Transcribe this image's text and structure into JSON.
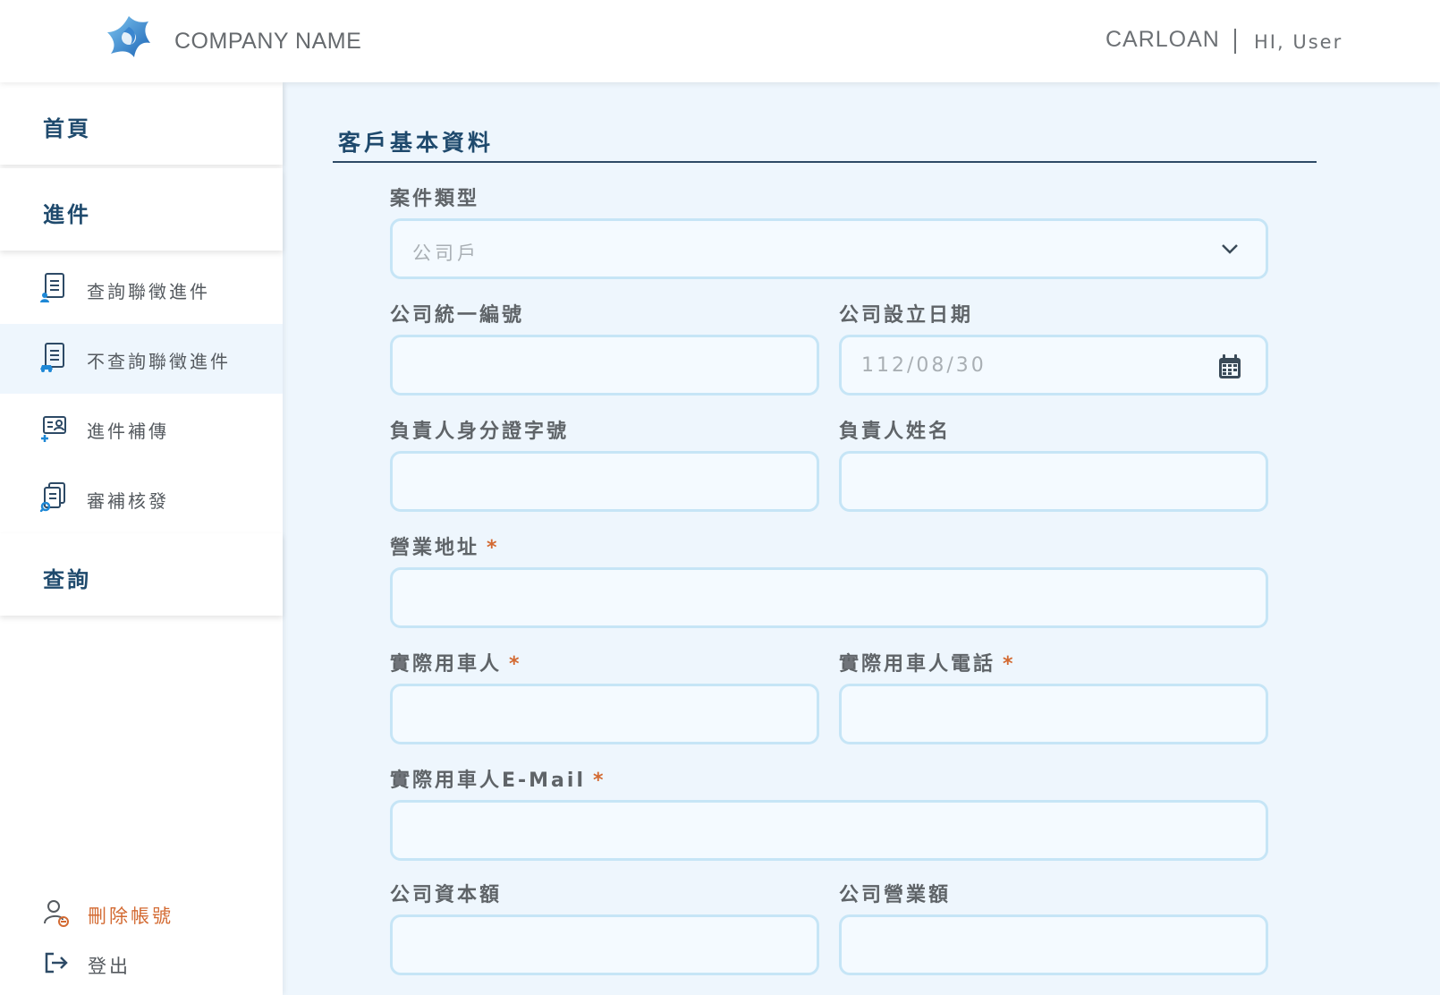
{
  "header": {
    "company_name": "COMPANY NAME",
    "app_name": "CARLOAN",
    "greeting": "HI, User"
  },
  "sidebar": {
    "home": "首頁",
    "intake": "進件",
    "intake_items": [
      {
        "label": "查詢聯徵進件",
        "icon": "document-person-icon"
      },
      {
        "label": "不查詢聯徵進件",
        "icon": "document-car-icon"
      },
      {
        "label": "進件補傳",
        "icon": "id-card-add-icon"
      },
      {
        "label": "審補核發",
        "icon": "documents-search-icon"
      }
    ],
    "active_item": "不查詢聯徵進件",
    "query": "查詢",
    "delete_account": "刪除帳號",
    "logout": "登出"
  },
  "form": {
    "title": "客戶基本資料",
    "case_type": {
      "label": "案件類型",
      "value": "公司戶"
    },
    "company_id": {
      "label": "公司統一編號",
      "value": ""
    },
    "established_date": {
      "label": "公司設立日期",
      "placeholder": "112/08/30"
    },
    "owner_id": {
      "label": "負責人身分證字號",
      "value": ""
    },
    "owner_name": {
      "label": "負責人姓名",
      "value": ""
    },
    "business_address": {
      "label": "營業地址",
      "required_mark": "*"
    },
    "actual_user": {
      "label": "實際用車人",
      "required_mark": "*"
    },
    "actual_user_phone": {
      "label": "實際用車人電話",
      "required_mark": "*"
    },
    "actual_user_email": {
      "label": "實際用車人E-Mail",
      "required_mark": "*"
    },
    "capital": {
      "label": "公司資本額",
      "value": ""
    },
    "revenue": {
      "label": "公司營業額",
      "value": ""
    }
  },
  "colors": {
    "brand_navy": "#1f4a6d",
    "accent_orange": "#d36a32",
    "field_border": "#c6e5f6",
    "main_bg": "#eef6fd"
  }
}
